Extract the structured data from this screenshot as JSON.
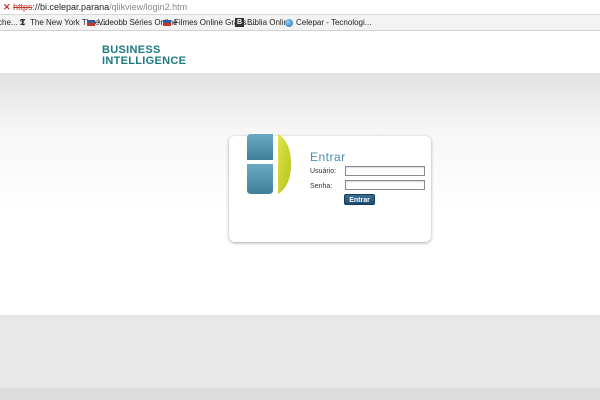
{
  "browser": {
    "url": {
      "scheme": "https",
      "separator": "://",
      "host": "bi.celepar.parana",
      "path": "/qlikview/login2.htm"
    },
    "bookmarks": [
      {
        "label": "che...",
        "icon": "page-icon"
      },
      {
        "label": "The New York Time...",
        "icon": "nyt-icon"
      },
      {
        "label": "Videobb Séries Online",
        "icon": "flag-icon"
      },
      {
        "label": "Filmes Online Gratis ...",
        "icon": "flag-icon"
      },
      {
        "label": "Bíblia Online",
        "icon": "bible-icon"
      },
      {
        "label": "Celepar - Tecnologi...",
        "icon": "globe-icon"
      }
    ]
  },
  "header": {
    "brand_line1": "BUSINESS",
    "brand_line2": "INTELLIGENCE"
  },
  "login": {
    "title": "Entrar",
    "username_label": "Usuário:",
    "username_value": "",
    "password_label": "Senha:",
    "password_value": "",
    "submit_label": "Entrar"
  },
  "colors": {
    "brand_teal": "#1c7b80",
    "title_blue": "#4a8fb0",
    "logo_blue": "#4f93ad",
    "logo_yellow": "#c9d325",
    "button_navy": "#1d4b70"
  }
}
